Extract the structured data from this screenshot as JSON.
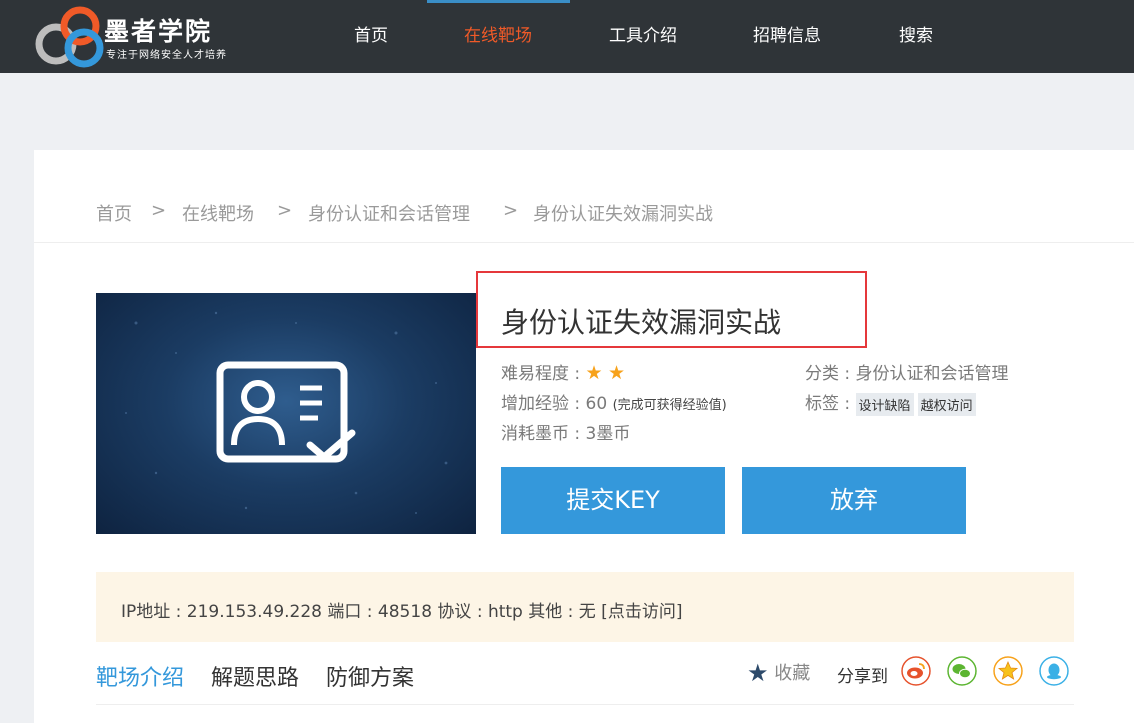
{
  "header": {
    "logo_title": "墨者学院",
    "logo_subtitle": "专注于网络安全人才培养",
    "nav": [
      "首页",
      "在线靶场",
      "工具介绍",
      "招聘信息",
      "搜索"
    ],
    "active_nav": "在线靶场"
  },
  "breadcrumb": {
    "items": [
      "首页",
      "在线靶场",
      "身份认证和会话管理",
      "身份认证失效漏洞实战"
    ],
    "separator": ">"
  },
  "challenge": {
    "title": "身份认证失效漏洞实战",
    "difficulty_label": "难易程度 :",
    "difficulty_stars": 2,
    "exp_label": "增加经验 : 60",
    "exp_note": "(完成可获得经验值)",
    "cost": "消耗墨币 : 3墨币",
    "category": "分类 : 身份认证和会话管理",
    "tags_label": "标签 :",
    "tags": [
      "设计缺陷",
      "越权访问"
    ],
    "submit_button": "提交KEY",
    "giveup_button": "放弃"
  },
  "info": {
    "text": "IP地址 : 219.153.49.228   端口 : 48518   协议 : http   其他 : 无   [点击访问]"
  },
  "tabs": {
    "items": [
      "靶场介绍",
      "解题思路",
      "防御方案"
    ],
    "active": "靶场介绍",
    "favorite": "收藏",
    "share_label": "分享到"
  },
  "colors": {
    "topbar": "#2f3438",
    "accent": "#3498db",
    "active_nav": "#f05a28",
    "highlight_box": "#e5383b",
    "star": "#f7a21b"
  },
  "icons": [
    "logo-cloud-icon",
    "star-icon",
    "favorite-star-icon",
    "weibo-icon",
    "wechat-icon",
    "qzone-icon",
    "qq-icon",
    "id-card-icon"
  ]
}
